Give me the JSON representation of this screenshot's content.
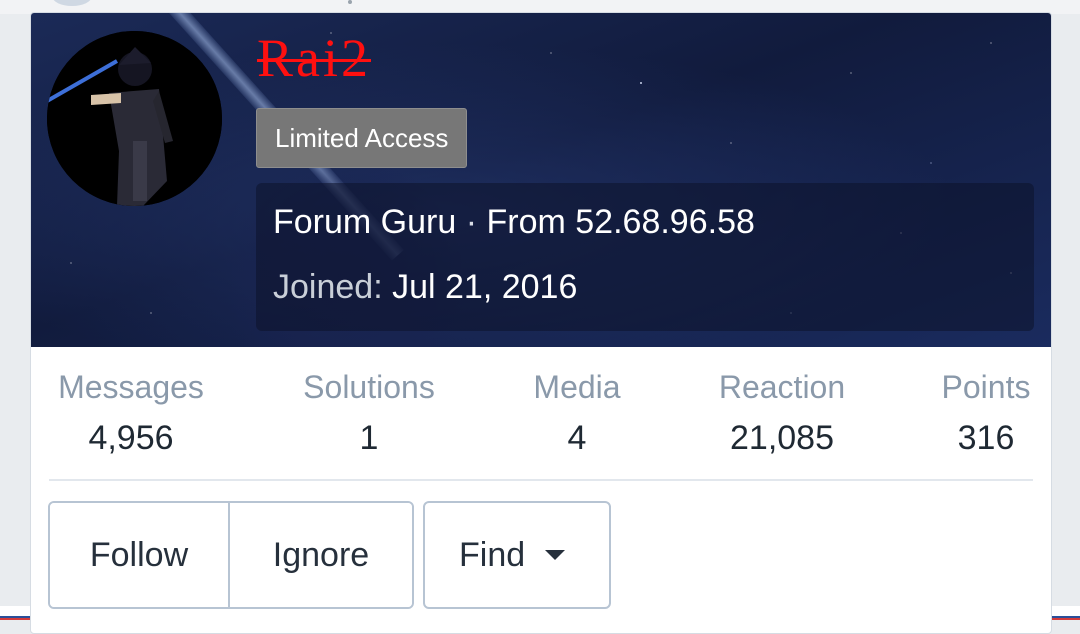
{
  "profile": {
    "username": "Rai2",
    "badge": "Limited Access",
    "title": "Forum Guru",
    "separator": "·",
    "from": "From 52.68.96.58",
    "joined_label": "Joined:",
    "joined_value": "Jul 21, 2016"
  },
  "stats": [
    {
      "label": "Messages",
      "value": "4,956"
    },
    {
      "label": "Solutions",
      "value": "1"
    },
    {
      "label": "Media",
      "value": "4"
    },
    {
      "label": "Reaction",
      "value": "21,085"
    },
    {
      "label": "Points",
      "value": "316"
    }
  ],
  "actions": {
    "follow": "Follow",
    "ignore": "Ignore",
    "find": "Find"
  },
  "colors": {
    "username": "#ff1010",
    "badge_bg": "#777777",
    "stat_label": "#8a99aa",
    "button_border": "#b7c4d3"
  },
  "icons": {
    "avatar": "anime-swordsman-avatar",
    "find_dropdown": "caret-down-icon"
  }
}
